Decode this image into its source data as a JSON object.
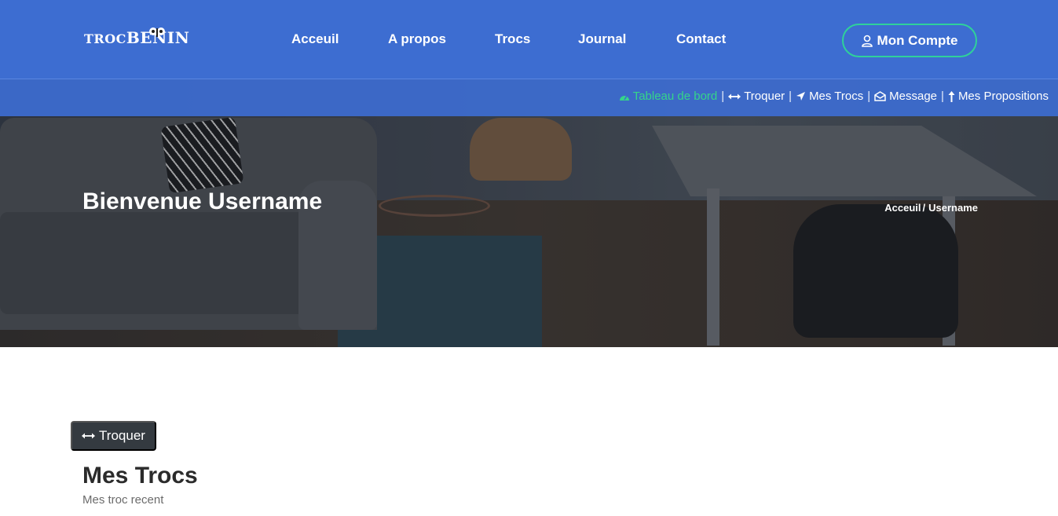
{
  "brand": {
    "logo_main": "TROCBENIN",
    "logo_part1": "TROC",
    "logo_part2": "BENIN"
  },
  "nav": {
    "links": [
      "Acceuil",
      "A propos",
      "Trocs",
      "Journal",
      "Contact"
    ],
    "account_label": "Mon Compte",
    "account_icon": "user-icon"
  },
  "subnav": {
    "items": [
      {
        "label": "Tableau de bord",
        "icon": "dashboard-icon",
        "active": true
      },
      {
        "label": "Troquer",
        "icon": "exchange-arrows-icon",
        "active": false
      },
      {
        "label": "Mes Trocs",
        "icon": "location-arrow-icon",
        "active": false
      },
      {
        "label": "Message",
        "icon": "envelope-open-icon",
        "active": false
      },
      {
        "label": "Mes Propositions",
        "icon": "long-arrow-up-icon",
        "active": false
      }
    ],
    "separator": "|"
  },
  "hero": {
    "title": "Bienvenue Username",
    "breadcrumb": [
      "Acceuil",
      "Username"
    ],
    "breadcrumb_separator": "/"
  },
  "main": {
    "action_button": "Troquer",
    "section_title": "Mes Trocs",
    "section_subtitle": "Mes troc recent"
  },
  "colors": {
    "navbar": "#3d6dd1",
    "accent_green": "#35d48a",
    "button_dark": "#343a40",
    "heading_text": "#2b2b2b"
  }
}
